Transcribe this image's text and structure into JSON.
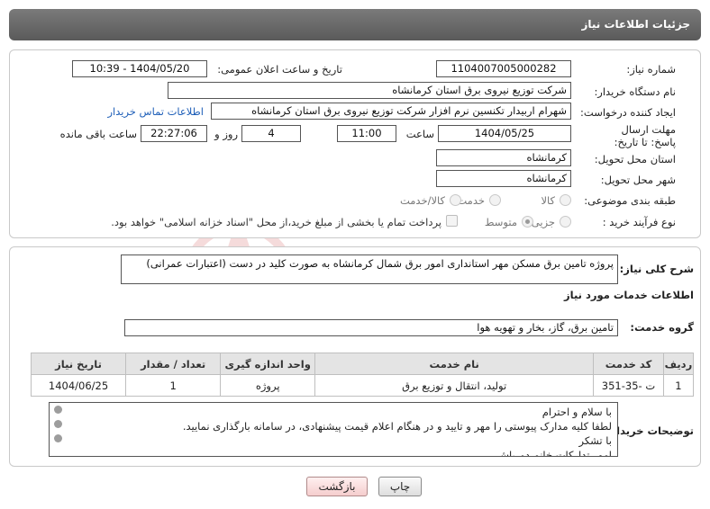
{
  "header": {
    "title": "جزئیات اطلاعات نیاز"
  },
  "fields": {
    "need_number_label": "شماره نیاز:",
    "need_number": "1104007005000282",
    "announce_label": "تاریخ و ساعت اعلان عمومی:",
    "announce_value": "1404/05/20 - 10:39",
    "buyer_org_label": "نام دستگاه خریدار:",
    "buyer_org": "شرکت توزیع نیروی برق استان کرمانشاه",
    "requester_label": "ایجاد کننده درخواست:",
    "requester": "شهرام اربیدار تکنسین نرم افزار شرکت توزیع نیروی برق استان کرمانشاه",
    "contact_link": "اطلاعات تماس خریدار",
    "deadline_label": "مهلت ارسال پاسخ: تا تاریخ:",
    "deadline_date": "1404/05/25",
    "time_label": "ساعت",
    "deadline_time": "11:00",
    "days_value": "4",
    "days_label": "روز و",
    "remaining_time": "22:27:06",
    "remaining_label": "ساعت باقی مانده",
    "province_label": "استان محل تحویل:",
    "province": "کرمانشاه",
    "city_label": "شهر محل تحویل:",
    "city": "کرمانشاه",
    "category_label": "طبقه بندی موضوعی:",
    "category_options": [
      "کالا",
      "خدمت",
      "کالا/خدمت"
    ],
    "process_label": "نوع فرآیند خرید :",
    "process_options": [
      "جزیی",
      "متوسط"
    ],
    "payment_note": "پرداخت تمام یا بخشی از مبلغ خرید،از محل \"اسناد خزانه اسلامی\" خواهد بود."
  },
  "summary": {
    "label": "شرح کلی نیاز:",
    "text": "پروژه تامین برق مسکن مهر استانداری امور برق شمال کرمانشاه به صورت کلید در دست (اعتبارات عمرانی)"
  },
  "services": {
    "section_title": "اطلاعات خدمات مورد نیاز",
    "group_label": "گروه خدمت:",
    "group_value": "تامین برق، گاز، بخار و تهویه هوا",
    "columns": [
      "ردیف",
      "کد خدمت",
      "نام خدمت",
      "واحد اندازه گیری",
      "تعداد / مقدار",
      "تاریخ نیاز"
    ],
    "rows": [
      [
        "1",
        "ت -35-351",
        "تولید، انتقال و توزیع برق",
        "پروژه",
        "1",
        "1404/06/25"
      ]
    ]
  },
  "buyer_notes": {
    "label": "توضیحات خریدار:",
    "lines": [
      "با سلام و احترام",
      "لطفا کلیه مدارک پیوستی را مهر و تایید و در هنگام اعلام قیمت پیشنهادی، در سامانه بارگذاری نمایید.",
      "با تشکر",
      "امور تدارکات خانم  دورباش"
    ]
  },
  "buttons": {
    "print": "چاپ",
    "back": "بازگشت"
  },
  "colors": {
    "header": "#6b6b6b",
    "link": "#1f5fb8",
    "back_button": "#f5cdcd"
  }
}
